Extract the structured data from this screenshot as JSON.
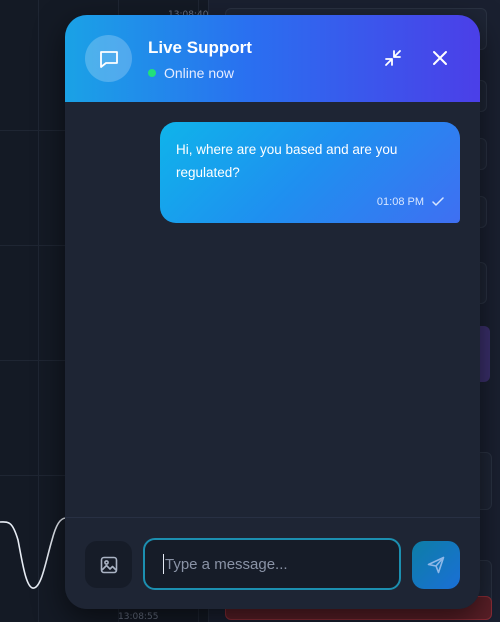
{
  "background": {
    "chart_time_bottom": "13:08:55",
    "chart_time_top": "13:08:40"
  },
  "chat": {
    "title": "Live Support",
    "status": "Online now",
    "status_color": "#22e07a",
    "header_icon": "chat-bubble-icon",
    "minimize_icon": "minimize-icon",
    "close_icon": "close-icon",
    "messages": [
      {
        "text": "Hi, where are you based and are you regulated?",
        "time": "01:08 PM",
        "status_icon": "check-icon"
      }
    ],
    "input": {
      "placeholder": "Type a message...",
      "value": ""
    },
    "attach_icon": "image-icon",
    "send_icon": "send-icon"
  }
}
